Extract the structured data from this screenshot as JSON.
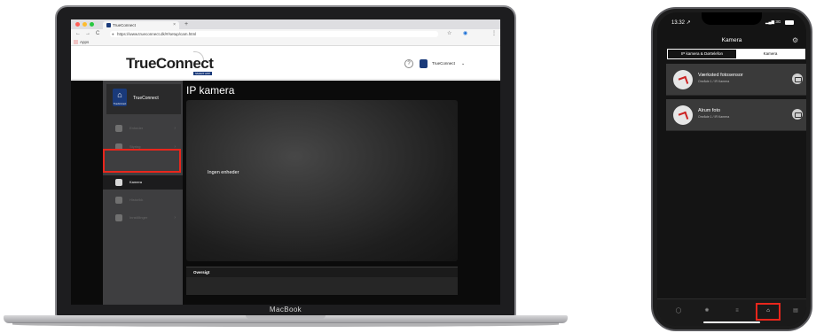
{
  "browser": {
    "tab_title": "TrueConnect",
    "tab_close": "×",
    "new_tab": "+",
    "nav_back": "←",
    "nav_forward": "→",
    "nav_reload": "C",
    "url": "https://www.trueconnect.dk/#/setup/cam.html",
    "bookmark_star": "☆",
    "menu": "⋮",
    "apps_label": "Apps"
  },
  "site": {
    "logo": "TrueConnect",
    "logo_sub": "SMART APP",
    "help": "?",
    "user_name": "TrueConnect",
    "user_caret": "⌄",
    "brand_name": "TrueConnect",
    "brand_icon_text": "TrueConnect",
    "nav": [
      {
        "label": "Enheder",
        "arrow": "›"
      },
      {
        "label": "Styring",
        "arrow": "›"
      },
      {
        "label": "Kamera",
        "arrow": ""
      },
      {
        "label": "Historikk",
        "arrow": ""
      },
      {
        "label": "Innstillinger",
        "arrow": "›"
      }
    ],
    "page_title": "IP kamera",
    "empty_message": "Ingen enheder",
    "overview_label": "Oversigt"
  },
  "laptop_brand": "MacBook",
  "phone": {
    "time": "13.32 ↗",
    "network": "3G",
    "title": "Kamera",
    "segments": [
      "IP kamera & Dørtelefon",
      "Kamera"
    ],
    "cameras": [
      {
        "name": "Værksted fotosensor",
        "area": "Område 1 / IR Kamera"
      },
      {
        "name": "Alrum foto",
        "area": "Område 1 / IR Kamera"
      }
    ],
    "tabs": [
      "shield-icon",
      "sun-icon",
      "sliders-icon",
      "camera-icon",
      "list-icon"
    ],
    "tab_glyphs": [
      "◯",
      "✺",
      "≡",
      "⌂",
      "▤"
    ]
  },
  "colors": {
    "highlight": "#e8261c",
    "brand_blue": "#1a3a7a",
    "active_nav": "#1c1c1d"
  }
}
